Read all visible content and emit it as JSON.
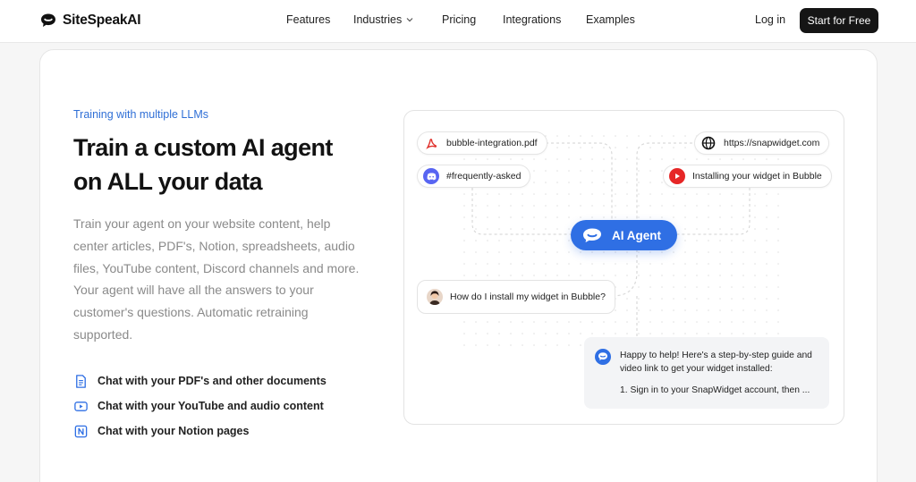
{
  "brand": {
    "name": "SiteSpeakAI",
    "accent": "#2f6fe4",
    "eyebrow_color": "#2f6fd6"
  },
  "nav": {
    "items": [
      {
        "label": "Features"
      },
      {
        "label": "Industries",
        "has_dropdown": true
      },
      {
        "label": "Pricing"
      },
      {
        "label": "Integrations"
      },
      {
        "label": "Examples"
      }
    ],
    "login_label": "Log in",
    "cta_label": "Start for Free"
  },
  "hero": {
    "eyebrow": "Training with multiple LLMs",
    "headline_line1": "Train a custom AI agent",
    "headline_line2": "on ALL your data",
    "body": "Train your agent on your website content, help center articles, PDF's, Notion, spreadsheets, audio files, YouTube content, Discord channels and more. Your agent will have all the answers to your customer's questions. Automatic retraining supported.",
    "features": [
      {
        "icon": "document-icon",
        "label": "Chat with your PDF's and other documents"
      },
      {
        "icon": "youtube-icon",
        "label": "Chat with your YouTube and audio content"
      },
      {
        "icon": "notion-icon",
        "label": "Chat with your Notion pages"
      }
    ]
  },
  "illustration": {
    "sources": [
      {
        "icon": "pdf-icon",
        "label": "bubble-integration.pdf"
      },
      {
        "icon": "discord-icon",
        "label": "#frequently-asked"
      },
      {
        "icon": "globe-icon",
        "label": "https://snapwidget.com"
      },
      {
        "icon": "youtube-play-icon",
        "label": "Installing your widget in Bubble"
      }
    ],
    "agent_label": "AI Agent",
    "question": "How do I install my widget in Bubble?",
    "answer": "Happy to help! Here's a step-by-step guide and video link to get your widget installed:",
    "answer_step": "1. Sign in to your SnapWidget account, then ..."
  }
}
